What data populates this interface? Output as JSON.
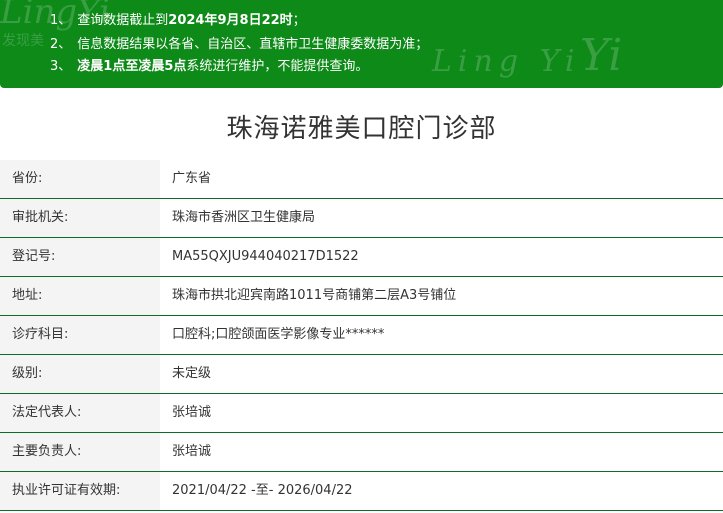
{
  "notice": {
    "items": [
      {
        "num": "1、",
        "pre": "查询数据截止到",
        "bold": "2024年9月8日22时",
        "post": "；"
      },
      {
        "num": "2、",
        "pre": "信息数据结果以各省、自治区、直辖市卫生健康委数据为准；",
        "bold": "",
        "post": ""
      },
      {
        "num": "3、",
        "pre": "",
        "bold": "凌晨1点至凌晨5点",
        "post": "系统进行维护，不能提供查询。"
      }
    ],
    "watermark": [
      "LingYi",
      "发现美",
      "Ling Yi",
      "Yi"
    ]
  },
  "title": "珠海诺雅美口腔门诊部",
  "details": [
    {
      "label": "省份:",
      "value": "广东省"
    },
    {
      "label": "审批机关:",
      "value": "珠海市香洲区卫生健康局"
    },
    {
      "label": "登记号:",
      "value": "MA55QXJU944040217D1522"
    },
    {
      "label": "地址:",
      "value": "珠海市拱北迎宾南路1011号商铺第二层A3号铺位"
    },
    {
      "label": "诊疗科目:",
      "value": "口腔科;口腔颌面医学影像专业******"
    },
    {
      "label": "级别:",
      "value": "未定级"
    },
    {
      "label": "法定代表人:",
      "value": "张培诚"
    },
    {
      "label": "主要负责人:",
      "value": "张培诚"
    },
    {
      "label": "执业许可证有效期:",
      "value": "2021/04/22 -至- 2026/04/22"
    }
  ]
}
